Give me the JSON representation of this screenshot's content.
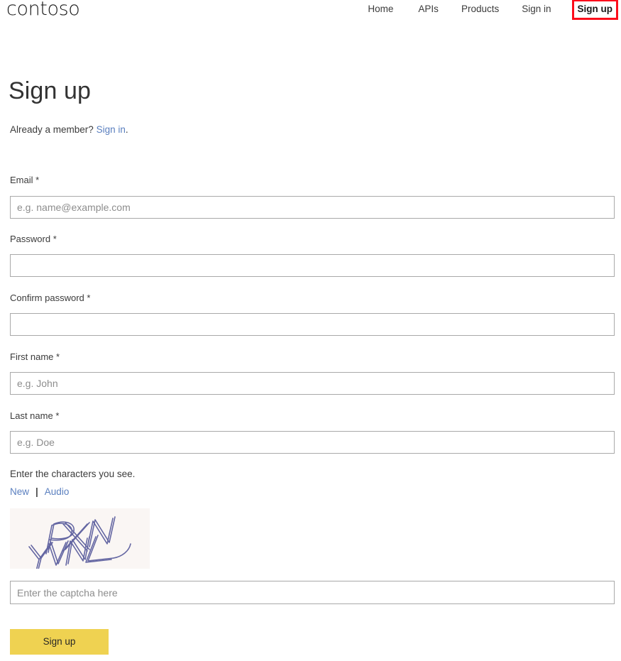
{
  "header": {
    "brand": "contoso",
    "nav": [
      {
        "label": "Home",
        "name": "nav-link-home",
        "highlighted": false
      },
      {
        "label": "APIs",
        "name": "nav-link-apis",
        "highlighted": false
      },
      {
        "label": "Products",
        "name": "nav-link-products",
        "highlighted": false
      },
      {
        "label": "Sign in",
        "name": "nav-link-sign-in",
        "highlighted": false
      },
      {
        "label": "Sign up",
        "name": "nav-link-sign-up",
        "highlighted": true
      }
    ],
    "highlight_color": "#fc0d1b"
  },
  "page": {
    "title": "Sign up",
    "member_prompt": "Already a member?",
    "member_link": "Sign in",
    "member_period": "."
  },
  "form": {
    "fields": [
      {
        "label": "Email *",
        "placeholder": "e.g. name@example.com",
        "value": ""
      },
      {
        "label": "Password *",
        "placeholder": "",
        "value": ""
      },
      {
        "label": "Confirm password *",
        "placeholder": "",
        "value": ""
      },
      {
        "label": "First name *",
        "placeholder": "e.g. John",
        "value": ""
      },
      {
        "label": "Last name *",
        "placeholder": "e.g. Doe",
        "value": ""
      }
    ]
  },
  "captcha": {
    "prompt": "Enter the characters you see.",
    "new_label": "New",
    "separator": "|",
    "audio_label": "Audio",
    "image_text": "PXN YVNL",
    "image_bg": "#faf6f4",
    "image_stroke": "#5c5f9e",
    "input_placeholder": "Enter the captcha here",
    "input_value": ""
  },
  "submit": {
    "label": "Sign up",
    "color": "#efd251"
  },
  "link_color": "#5a7fbf"
}
